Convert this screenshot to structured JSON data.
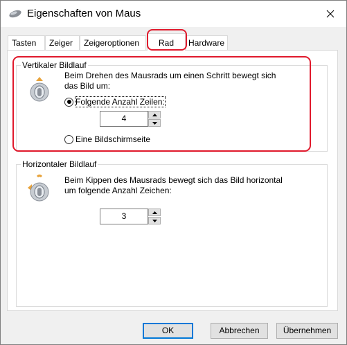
{
  "window": {
    "title": "Eigenschaften von Maus",
    "close_label": "✕"
  },
  "tabs": [
    {
      "label": "Tasten",
      "active": false
    },
    {
      "label": "Zeiger",
      "active": false
    },
    {
      "label": "Zeigeroptionen",
      "active": false
    },
    {
      "label": "Rad",
      "active": true
    },
    {
      "label": "Hardware",
      "active": false
    }
  ],
  "vertical": {
    "legend": "Vertikaler Bildlauf",
    "description_line1": "Beim Drehen des Mausrads um einen Schritt bewegt sich",
    "description_line2": "das Bild um:",
    "option_lines_label": "Folgende Anzahl Zeilen:",
    "option_lines_selected": true,
    "lines_value": "4",
    "option_page_label": "Eine Bildschirmseite",
    "option_page_selected": false
  },
  "horizontal": {
    "legend": "Horizontaler Bildlauf",
    "description_line1": "Beim Kippen des Mausrads bewegt sich das Bild horizontal",
    "description_line2": "um folgende Anzahl Zeichen:",
    "chars_value": "3"
  },
  "buttons": {
    "ok": "OK",
    "cancel": "Abbrechen",
    "apply": "Übernehmen"
  },
  "colors": {
    "highlight": "#e0192c",
    "default_button_border": "#0078d7"
  }
}
